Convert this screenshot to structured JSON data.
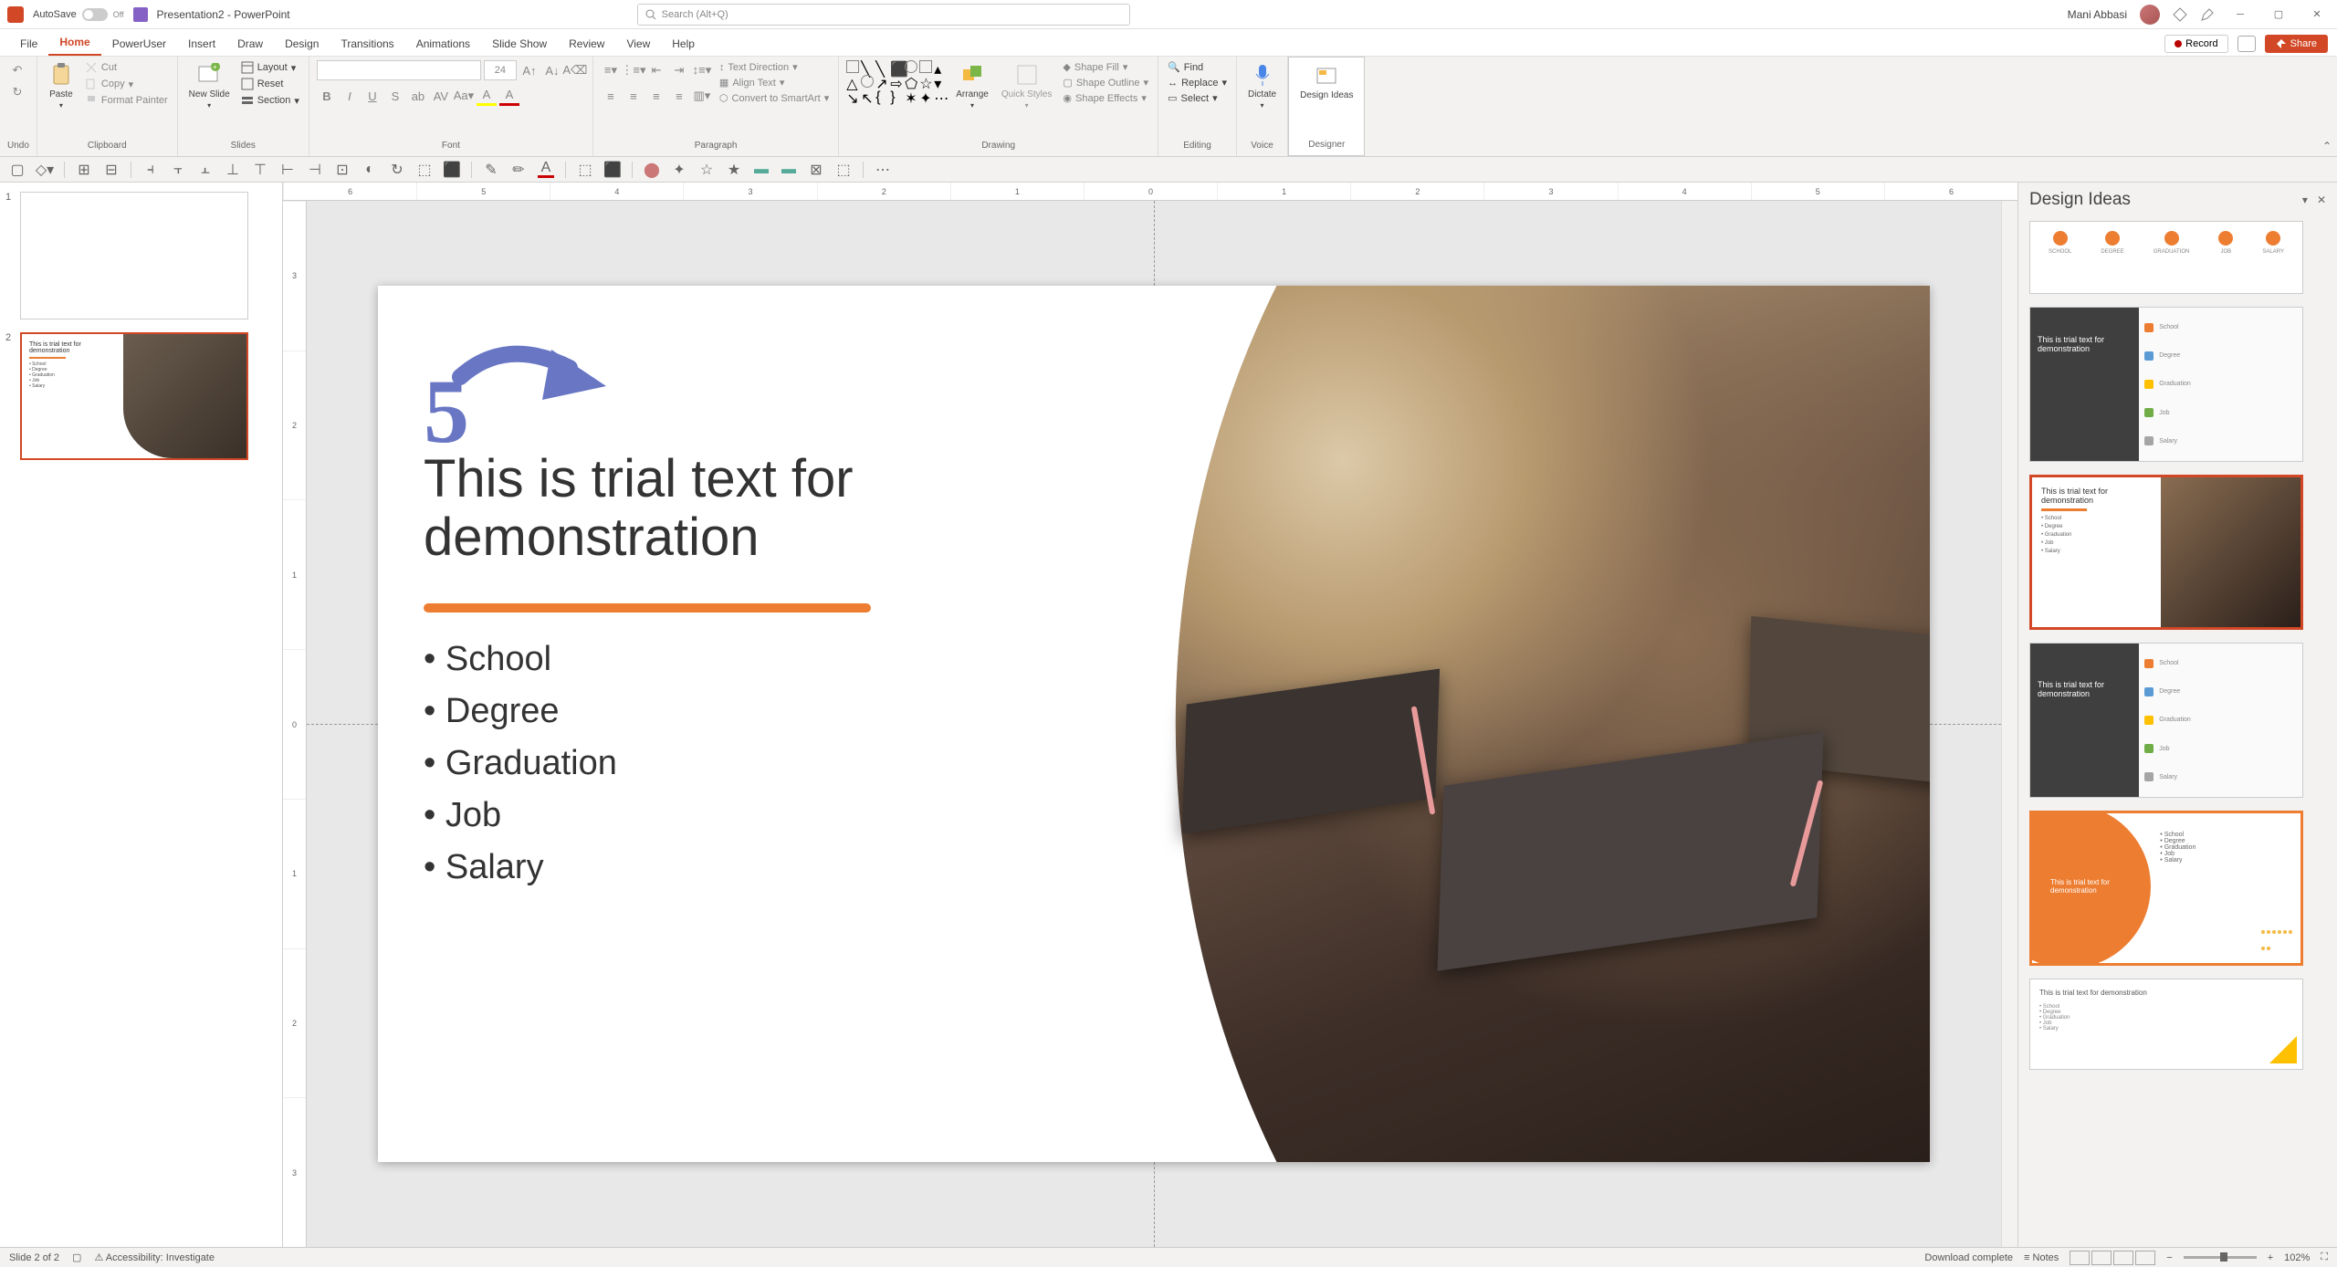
{
  "titlebar": {
    "autosave": "AutoSave",
    "autosave_state": "Off",
    "document": "Presentation2 - PowerPoint",
    "search_placeholder": "Search (Alt+Q)",
    "user": "Mani Abbasi"
  },
  "tabs": {
    "file": "File",
    "home": "Home",
    "poweruser": "PowerUser",
    "insert": "Insert",
    "draw": "Draw",
    "design": "Design",
    "transitions": "Transitions",
    "animations": "Animations",
    "slideshow": "Slide Show",
    "review": "Review",
    "view": "View",
    "help": "Help",
    "record": "Record",
    "share": "Share"
  },
  "ribbon": {
    "undo_group": "Undo",
    "paste": "Paste",
    "cut": "Cut",
    "copy": "Copy",
    "format_painter": "Format Painter",
    "clipboard_group": "Clipboard",
    "new_slide": "New Slide",
    "layout": "Layout",
    "reset": "Reset",
    "section": "Section",
    "slides_group": "Slides",
    "font_size": "24",
    "font_group": "Font",
    "paragraph_group": "Paragraph",
    "text_direction": "Text Direction",
    "align_text": "Align Text",
    "convert_smartart": "Convert to SmartArt",
    "arrange": "Arrange",
    "quick_styles": "Quick Styles",
    "shape_fill": "Shape Fill",
    "shape_outline": "Shape Outline",
    "shape_effects": "Shape Effects",
    "drawing_group": "Drawing",
    "find": "Find",
    "replace": "Replace",
    "select": "Select",
    "editing_group": "Editing",
    "dictate": "Dictate",
    "voice_group": "Voice",
    "design_ideas": "Design Ideas",
    "designer_group": "Designer"
  },
  "slide": {
    "five": "5",
    "title": "This is trial text for demonstration",
    "bullets": [
      "School",
      "Degree",
      "Graduation",
      "Job",
      "Salary"
    ]
  },
  "thumbnails": {
    "slide1_num": "1",
    "slide2_num": "2"
  },
  "design_pane": {
    "title": "Design Ideas",
    "idea_text": "This is trial text for demonstration",
    "bullets": [
      "School",
      "Degree",
      "Graduation",
      "Job",
      "Salary"
    ],
    "cats": [
      "SCHOOL",
      "DEGREE",
      "GRADUATION",
      "JOB",
      "SALARY"
    ]
  },
  "ruler_h": [
    "6",
    "5",
    "4",
    "3",
    "2",
    "1",
    "0",
    "1",
    "2",
    "3",
    "4",
    "5",
    "6"
  ],
  "ruler_v": [
    "3",
    "2",
    "1",
    "0",
    "1",
    "2",
    "3"
  ],
  "statusbar": {
    "slide": "Slide 2 of 2",
    "accessibility": "Accessibility: Investigate",
    "download": "Download complete",
    "notes": "Notes",
    "zoom": "102%"
  }
}
